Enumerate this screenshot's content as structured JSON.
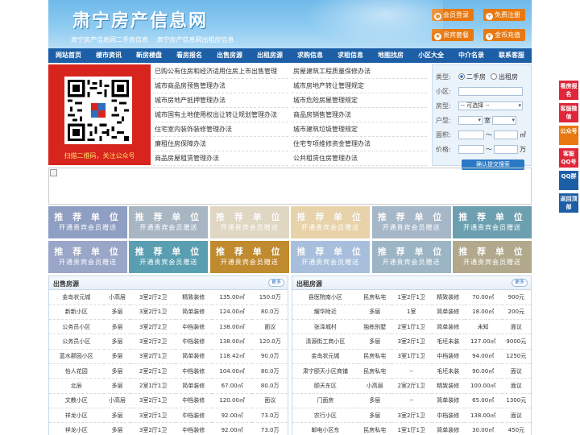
{
  "header": {
    "title": "肃宁房产信息网",
    "subtitle": [
      "肃宁房产信息网二手房信息",
      "肃宁房产信息网出租房信息"
    ],
    "buttons": [
      {
        "label": "会员登录",
        "icon": "user-icon"
      },
      {
        "label": "免费注册",
        "icon": "register-icon"
      },
      {
        "label": "贵宾套餐",
        "icon": "vip-icon"
      },
      {
        "label": "金币充值",
        "icon": "coin-icon"
      }
    ]
  },
  "nav": [
    "网站首页",
    "楼市资讯",
    "新房楼盘",
    "看房报名",
    "出售房源",
    "出租房源",
    "求购信息",
    "求租信息",
    "地图找房",
    "小区大全",
    "中介名录",
    "联系客服"
  ],
  "qr": {
    "caption": "扫描二维码，关注公众号"
  },
  "news": {
    "left": [
      "已购公有住房和经济适用住房上市出售管理",
      "城市商品房预售管理办法",
      "城市房地产抵押管理办法",
      "城市国有土地使用权出让转让规划管理办法",
      "住宅室内装饰装修管理办法",
      "廉租住房保障办法",
      "商品房屋租赁管理办法"
    ],
    "right": [
      "房屋建筑工程质量保修办法",
      "城市房地产转让管理规定",
      "城市危险房屋管理规定",
      "商品房销售管理办法",
      "城市建筑垃圾管理规定",
      "住宅专项维修资金管理办法",
      "公共租赁住房管理办法"
    ]
  },
  "search": {
    "type_label": "类型:",
    "opt1": "二手房",
    "opt2": "出租房",
    "community_label": "小区:",
    "house_type_label": "房型:",
    "house_type_value": "-- 可选择 --",
    "layout_label": "户型:",
    "layout_unit": "室",
    "area_label": "面积:",
    "area_sep": "～",
    "area_unit": "㎡",
    "price_label": "价格:",
    "price_sep": "～",
    "price_unit": "万",
    "submit": "确认提交搜索"
  },
  "recommend": {
    "line1": "推 荐 单 位",
    "line2": "开通贵宾会员赠送",
    "colors": [
      "#8f9ec3",
      "#a8b6c4",
      "#e0d7c3",
      "#e8d2aa",
      "#a6b7c8",
      "#6c9fb0",
      "#9aa6c8",
      "#5a9fb1",
      "#c08a2e",
      "#a7bfdc",
      "#9bb5c5",
      "#b2a98c"
    ]
  },
  "sale": {
    "title": "出售房源",
    "more": "更多",
    "rows": [
      [
        "金岛状元城",
        "小高层",
        "3室2厅2卫",
        "精致装修",
        "135.00㎡",
        "150.0万"
      ],
      [
        "新新小区",
        "多层",
        "3室2厅1卫",
        "简单装修",
        "124.00㎡",
        "80.0万"
      ],
      [
        "公务员小区",
        "多层",
        "3室2厅2卫",
        "中档装修",
        "138.00㎡",
        "面议"
      ],
      [
        "公务员小区",
        "多层",
        "3室2厅2卫",
        "中档装修",
        "138.00㎡",
        "120.0万"
      ],
      [
        "蓝水郡园小区",
        "多层",
        "3室2厅1卫",
        "简单装修",
        "118.42㎡",
        "90.0万"
      ],
      [
        "怡人花园",
        "多层",
        "2室2厅1卫",
        "中档装修",
        "104.00㎡",
        "80.0万"
      ],
      [
        "北辰",
        "多层",
        "2室1厅1卫",
        "简单装修",
        "67.00㎡",
        "80.0万"
      ],
      [
        "文教小区",
        "小高层",
        "3室2厅1卫",
        "中档装修",
        "120.00㎡",
        "面议"
      ],
      [
        "祥龙小区",
        "多层",
        "3室2厅1卫",
        "中档装修",
        "92.00㎡",
        "73.0万"
      ],
      [
        "祥龙小区",
        "多层",
        "3室2厅1卫",
        "中档装修",
        "92.00㎡",
        "73.0万"
      ]
    ]
  },
  "rent": {
    "title": "出租房源",
    "more": "更多",
    "rows": [
      [
        "县医院南小区",
        "民房私宅",
        "1室2厅1卫",
        "精致装修",
        "70.00㎡",
        "900元"
      ],
      [
        "耀华附近",
        "多层",
        "1室",
        "简单装修",
        "18.00㎡",
        "200元"
      ],
      [
        "张泽城村",
        "独栋别墅",
        "2室1厅1卫",
        "简单装修",
        "未知",
        "面议"
      ],
      [
        "清源街工商小区",
        "多层",
        "3室2厅1卫",
        "毛坯未装",
        "127.00㎡",
        "9000元"
      ],
      [
        "金岛状元城",
        "民房私宅",
        "3室1厅1卫",
        "中档装修",
        "94.00㎡",
        "1250元"
      ],
      [
        "肃宁颐天小区商铺",
        "民房私宅",
        "--",
        "毛坯未装",
        "90.00㎡",
        "面议"
      ],
      [
        "颐天东区",
        "小高层",
        "2室2厅1卫",
        "精致装修",
        "100.00㎡",
        "面议"
      ],
      [
        "门面房",
        "多层",
        "--",
        "简单装修",
        "65.00㎡",
        "1300元"
      ],
      [
        "农行小区",
        "多层",
        "3室2厅1卫",
        "中档装修",
        "138.00㎡",
        "面议"
      ],
      [
        "邮电小区东",
        "民房私宅",
        "1室1厅1卫",
        "简单装修",
        "30.00㎡",
        "450元"
      ]
    ]
  },
  "side": [
    {
      "label": "看房报名",
      "color": "#e0263a"
    },
    {
      "label": "客服微信",
      "color": "#e0263a"
    },
    {
      "label": "公众号",
      "color": "#e8780f"
    },
    {
      "label": "客服QQ号",
      "color": "#e0263a"
    },
    {
      "label": "QQ群",
      "color": "#1d5fa6"
    },
    {
      "label": "返回顶部",
      "color": "#1d5fa6"
    }
  ]
}
